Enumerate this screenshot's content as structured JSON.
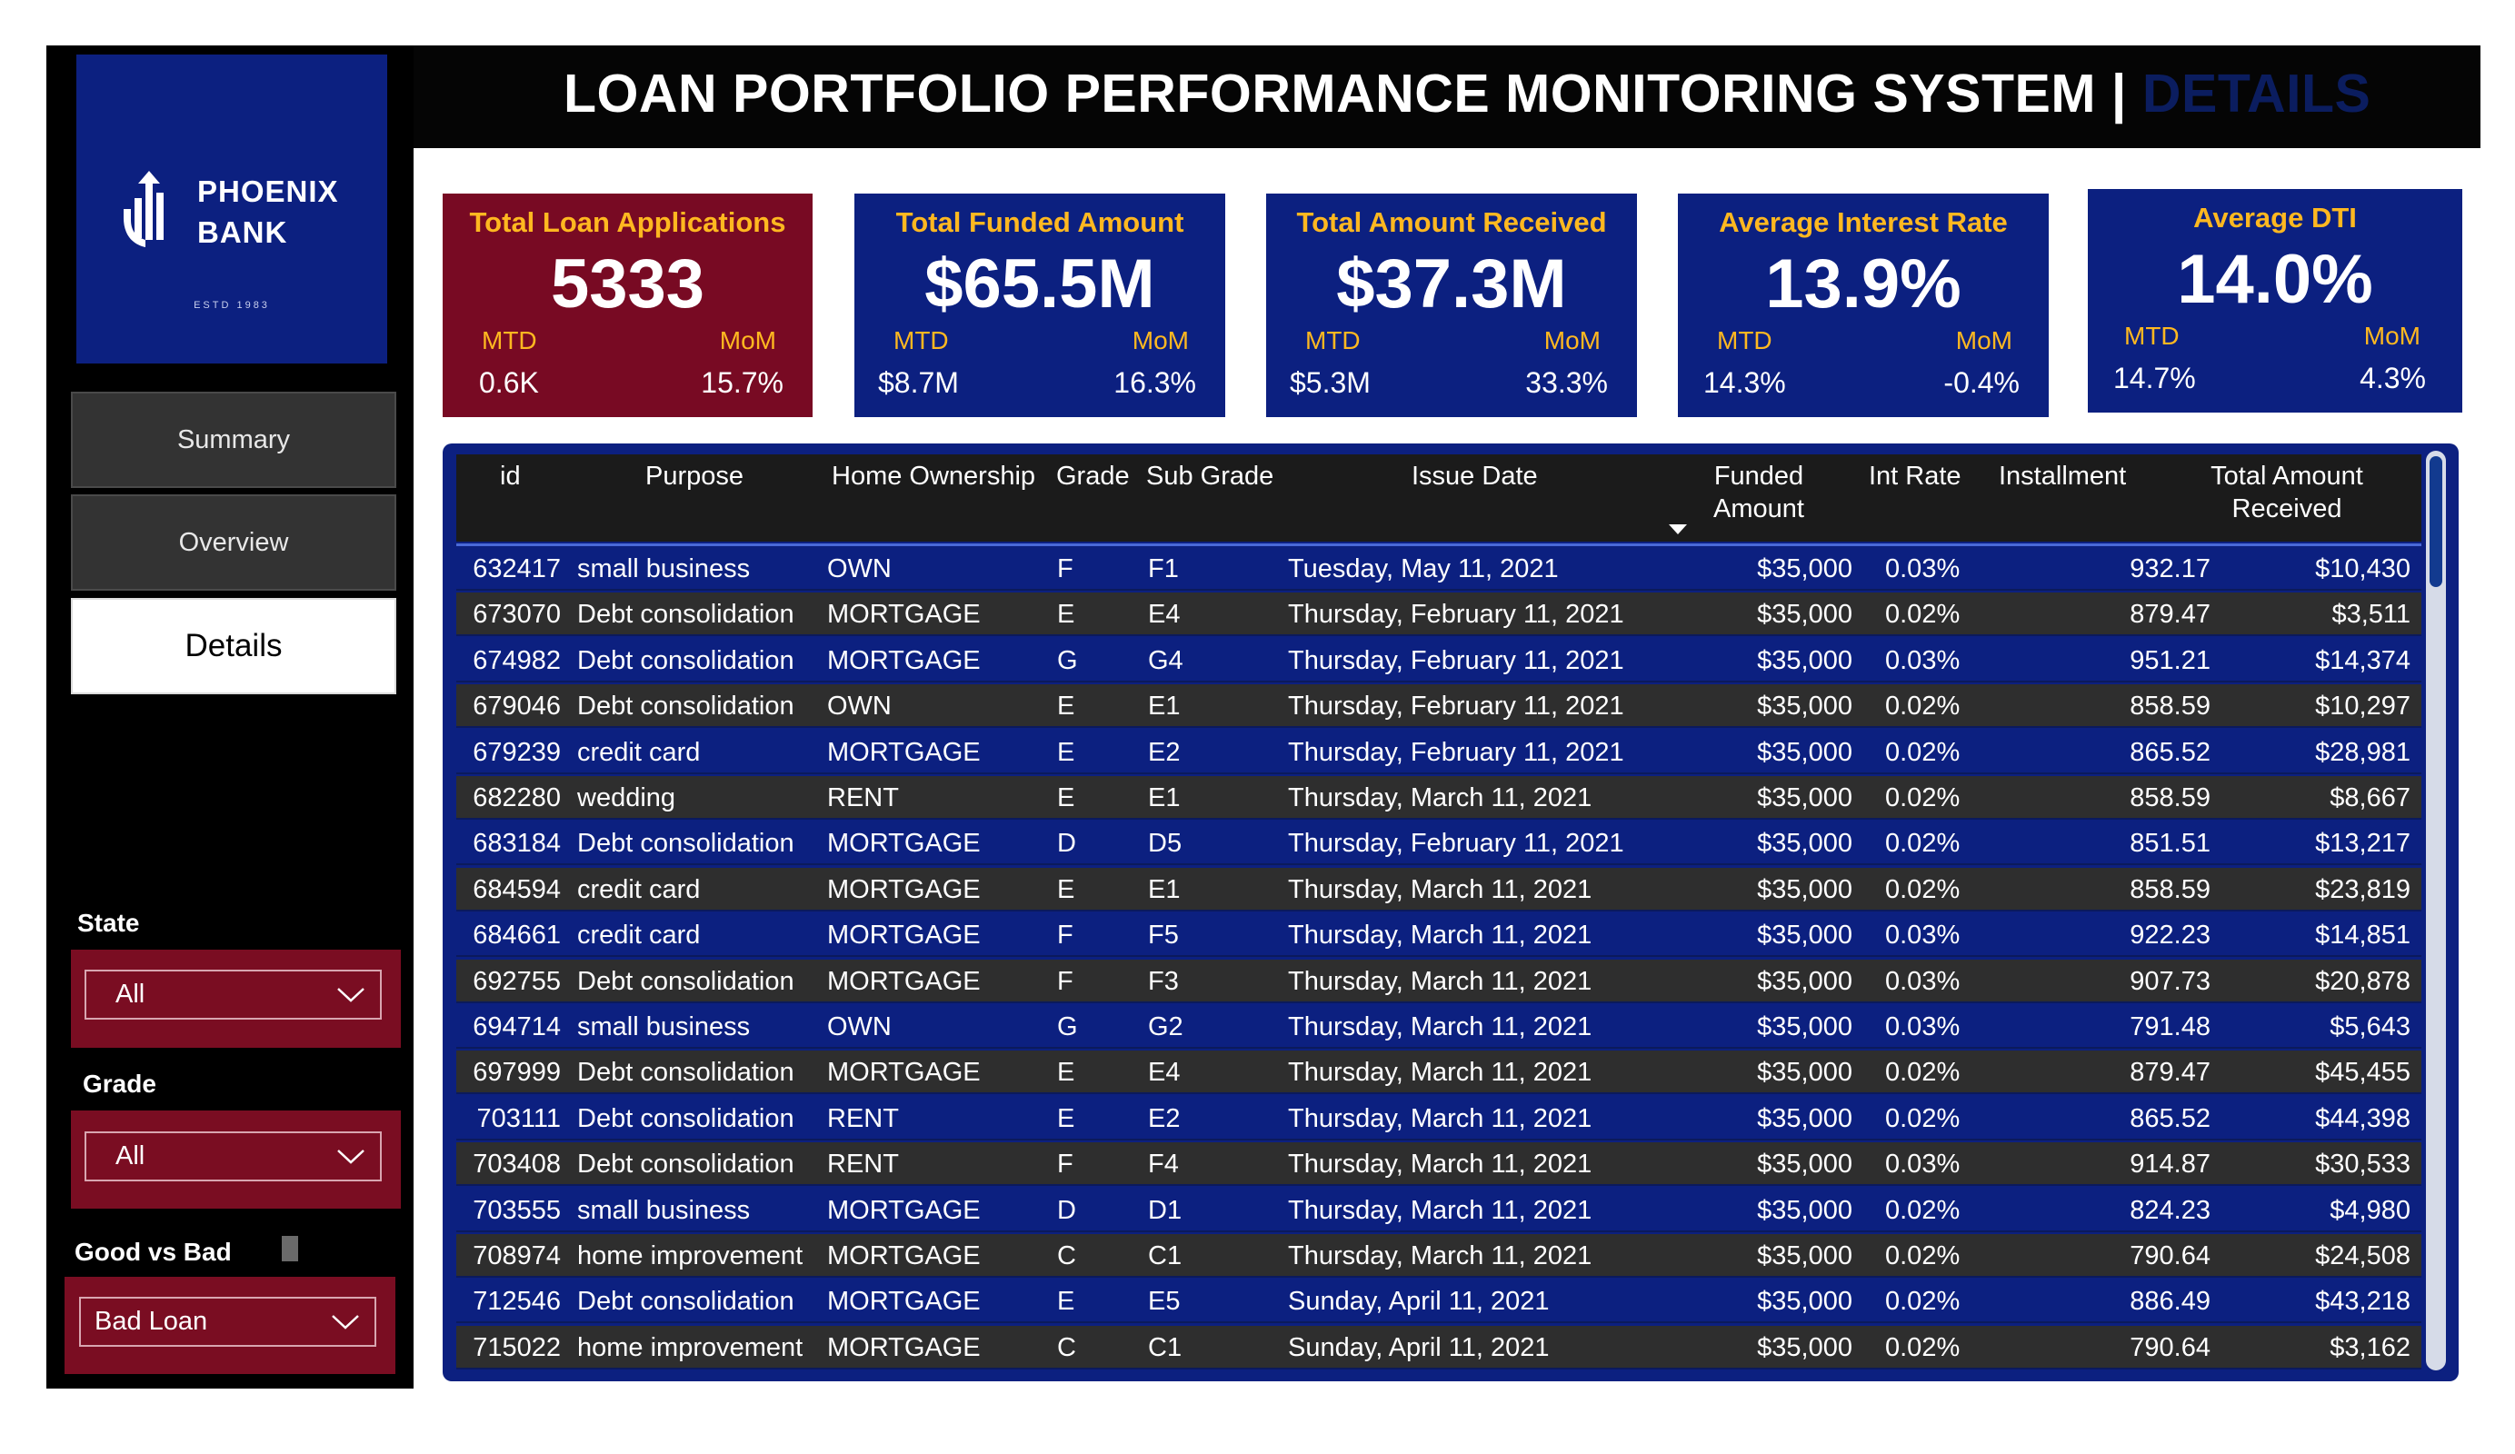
{
  "header": {
    "title": "LOAN PORTFOLIO PERFORMANCE MONITORING SYSTEM |",
    "title_accent": "DETAILS"
  },
  "logo": {
    "line1": "PHOENIX",
    "line2": "BANK",
    "estd": "ESTD 1983"
  },
  "nav": [
    {
      "label": "Summary",
      "active": false
    },
    {
      "label": "Overview",
      "active": false
    },
    {
      "label": "Details",
      "active": true
    }
  ],
  "filters": {
    "state": {
      "label": "State",
      "value": "All"
    },
    "grade": {
      "label": "Grade",
      "value": "All"
    },
    "good_vs_bad": {
      "label": "Good vs Bad",
      "value": "Bad Loan"
    }
  },
  "kpis": [
    {
      "title": "Total Loan Applications",
      "value": "5333",
      "mtd_label": "MTD",
      "mom_label": "MoM",
      "mtd": "0.6K",
      "mom": "15.7%"
    },
    {
      "title": "Total Funded Amount",
      "value": "$65.5M",
      "mtd_label": "MTD",
      "mom_label": "MoM",
      "mtd": "$8.7M",
      "mom": "16.3%"
    },
    {
      "title": "Total Amount Received",
      "value": "$37.3M",
      "mtd_label": "MTD",
      "mom_label": "MoM",
      "mtd": "$5.3M",
      "mom": "33.3%"
    },
    {
      "title": "Average Interest Rate",
      "value": "13.9%",
      "mtd_label": "MTD",
      "mom_label": "MoM",
      "mtd": "14.3%",
      "mom": "-0.4%"
    },
    {
      "title": "Average DTI",
      "value": "14.0%",
      "mtd_label": "MTD",
      "mom_label": "MoM",
      "mtd": "14.7%",
      "mom": "4.3%"
    }
  ],
  "colors": {
    "red_card": "#780a23",
    "blue_card": "#0c2080",
    "accent_text": "#ffb820",
    "mtd_text": "#ffb820",
    "title_accent": "#0b1d5f"
  },
  "table": {
    "columns": [
      "id",
      "Purpose",
      "Home Ownership",
      "Grade",
      "Sub Grade",
      "Issue Date",
      "Funded Amount",
      "Int Rate",
      "Installment",
      "Total Amount Received"
    ],
    "rows": [
      [
        "632417",
        "small business",
        "OWN",
        "F",
        "F1",
        "Tuesday, May 11, 2021",
        "$35,000",
        "0.03%",
        "932.17",
        "$10,430"
      ],
      [
        "673070",
        "Debt consolidation",
        "MORTGAGE",
        "E",
        "E4",
        "Thursday, February 11, 2021",
        "$35,000",
        "0.02%",
        "879.47",
        "$3,511"
      ],
      [
        "674982",
        "Debt consolidation",
        "MORTGAGE",
        "G",
        "G4",
        "Thursday, February 11, 2021",
        "$35,000",
        "0.03%",
        "951.21",
        "$14,374"
      ],
      [
        "679046",
        "Debt consolidation",
        "OWN",
        "E",
        "E1",
        "Thursday, February 11, 2021",
        "$35,000",
        "0.02%",
        "858.59",
        "$10,297"
      ],
      [
        "679239",
        "credit card",
        "MORTGAGE",
        "E",
        "E2",
        "Thursday, February 11, 2021",
        "$35,000",
        "0.02%",
        "865.52",
        "$28,981"
      ],
      [
        "682280",
        "wedding",
        "RENT",
        "E",
        "E1",
        "Thursday, March 11, 2021",
        "$35,000",
        "0.02%",
        "858.59",
        "$8,667"
      ],
      [
        "683184",
        "Debt consolidation",
        "MORTGAGE",
        "D",
        "D5",
        "Thursday, February 11, 2021",
        "$35,000",
        "0.02%",
        "851.51",
        "$13,217"
      ],
      [
        "684594",
        "credit card",
        "MORTGAGE",
        "E",
        "E1",
        "Thursday, March 11, 2021",
        "$35,000",
        "0.02%",
        "858.59",
        "$23,819"
      ],
      [
        "684661",
        "credit card",
        "MORTGAGE",
        "F",
        "F5",
        "Thursday, March 11, 2021",
        "$35,000",
        "0.03%",
        "922.23",
        "$14,851"
      ],
      [
        "692755",
        "Debt consolidation",
        "MORTGAGE",
        "F",
        "F3",
        "Thursday, March 11, 2021",
        "$35,000",
        "0.03%",
        "907.73",
        "$20,878"
      ],
      [
        "694714",
        "small business",
        "OWN",
        "G",
        "G2",
        "Thursday, March 11, 2021",
        "$35,000",
        "0.03%",
        "791.48",
        "$5,643"
      ],
      [
        "697999",
        "Debt consolidation",
        "MORTGAGE",
        "E",
        "E4",
        "Thursday, March 11, 2021",
        "$35,000",
        "0.02%",
        "879.47",
        "$45,455"
      ],
      [
        "703111",
        "Debt consolidation",
        "RENT",
        "E",
        "E2",
        "Thursday, March 11, 2021",
        "$35,000",
        "0.02%",
        "865.52",
        "$44,398"
      ],
      [
        "703408",
        "Debt consolidation",
        "RENT",
        "F",
        "F4",
        "Thursday, March 11, 2021",
        "$35,000",
        "0.03%",
        "914.87",
        "$30,533"
      ],
      [
        "703555",
        "small business",
        "MORTGAGE",
        "D",
        "D1",
        "Thursday, March 11, 2021",
        "$35,000",
        "0.02%",
        "824.23",
        "$4,980"
      ],
      [
        "708974",
        "home improvement",
        "MORTGAGE",
        "C",
        "C1",
        "Thursday, March 11, 2021",
        "$35,000",
        "0.02%",
        "790.64",
        "$24,508"
      ],
      [
        "712546",
        "Debt consolidation",
        "MORTGAGE",
        "E",
        "E5",
        "Sunday, April 11, 2021",
        "$35,000",
        "0.02%",
        "886.49",
        "$43,218"
      ],
      [
        "715022",
        "home improvement",
        "MORTGAGE",
        "C",
        "C1",
        "Sunday, April 11, 2021",
        "$35,000",
        "0.02%",
        "790.64",
        "$3,162"
      ]
    ]
  }
}
